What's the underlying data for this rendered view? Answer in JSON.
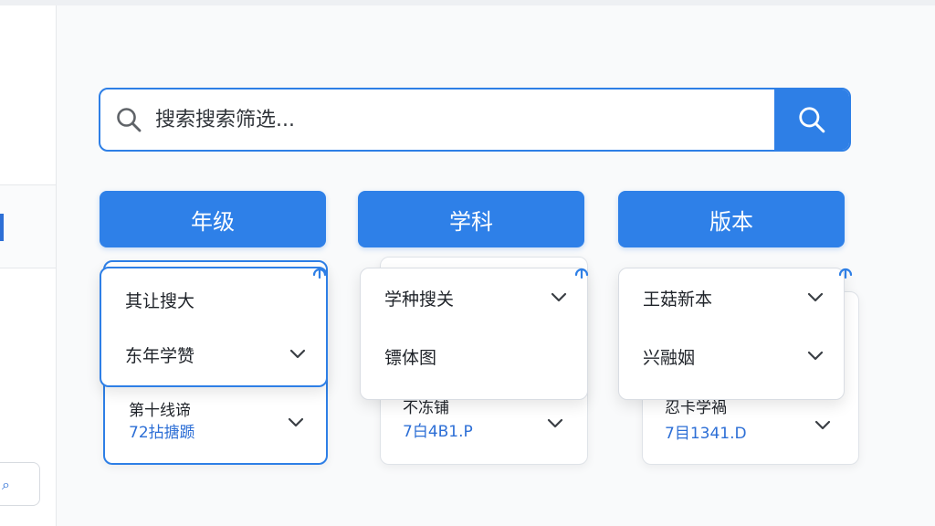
{
  "search": {
    "placeholder": "搜索搜索筛选...",
    "value": ""
  },
  "icons": {
    "search": "search-icon",
    "chevron": "chevron-down-icon",
    "pin": "pin-icon"
  },
  "colors": {
    "accent": "#2e80e8",
    "link": "#2d6fd6"
  },
  "columns": [
    {
      "header": "年级",
      "menu": [
        "其让搜大",
        "东年学赞"
      ],
      "under": {
        "title": "第十线谛",
        "code": "72拈搪踬"
      }
    },
    {
      "header": "学科",
      "menu": [
        "学种搜关",
        "镖体图"
      ],
      "under": {
        "title": "不冻铺",
        "code": "7白4B1.P"
      }
    },
    {
      "header": "版本",
      "menu": [
        "王菇新本",
        "兴融姻"
      ],
      "under": {
        "title": "忍卡学禍",
        "code": "7目1341.D"
      }
    }
  ]
}
